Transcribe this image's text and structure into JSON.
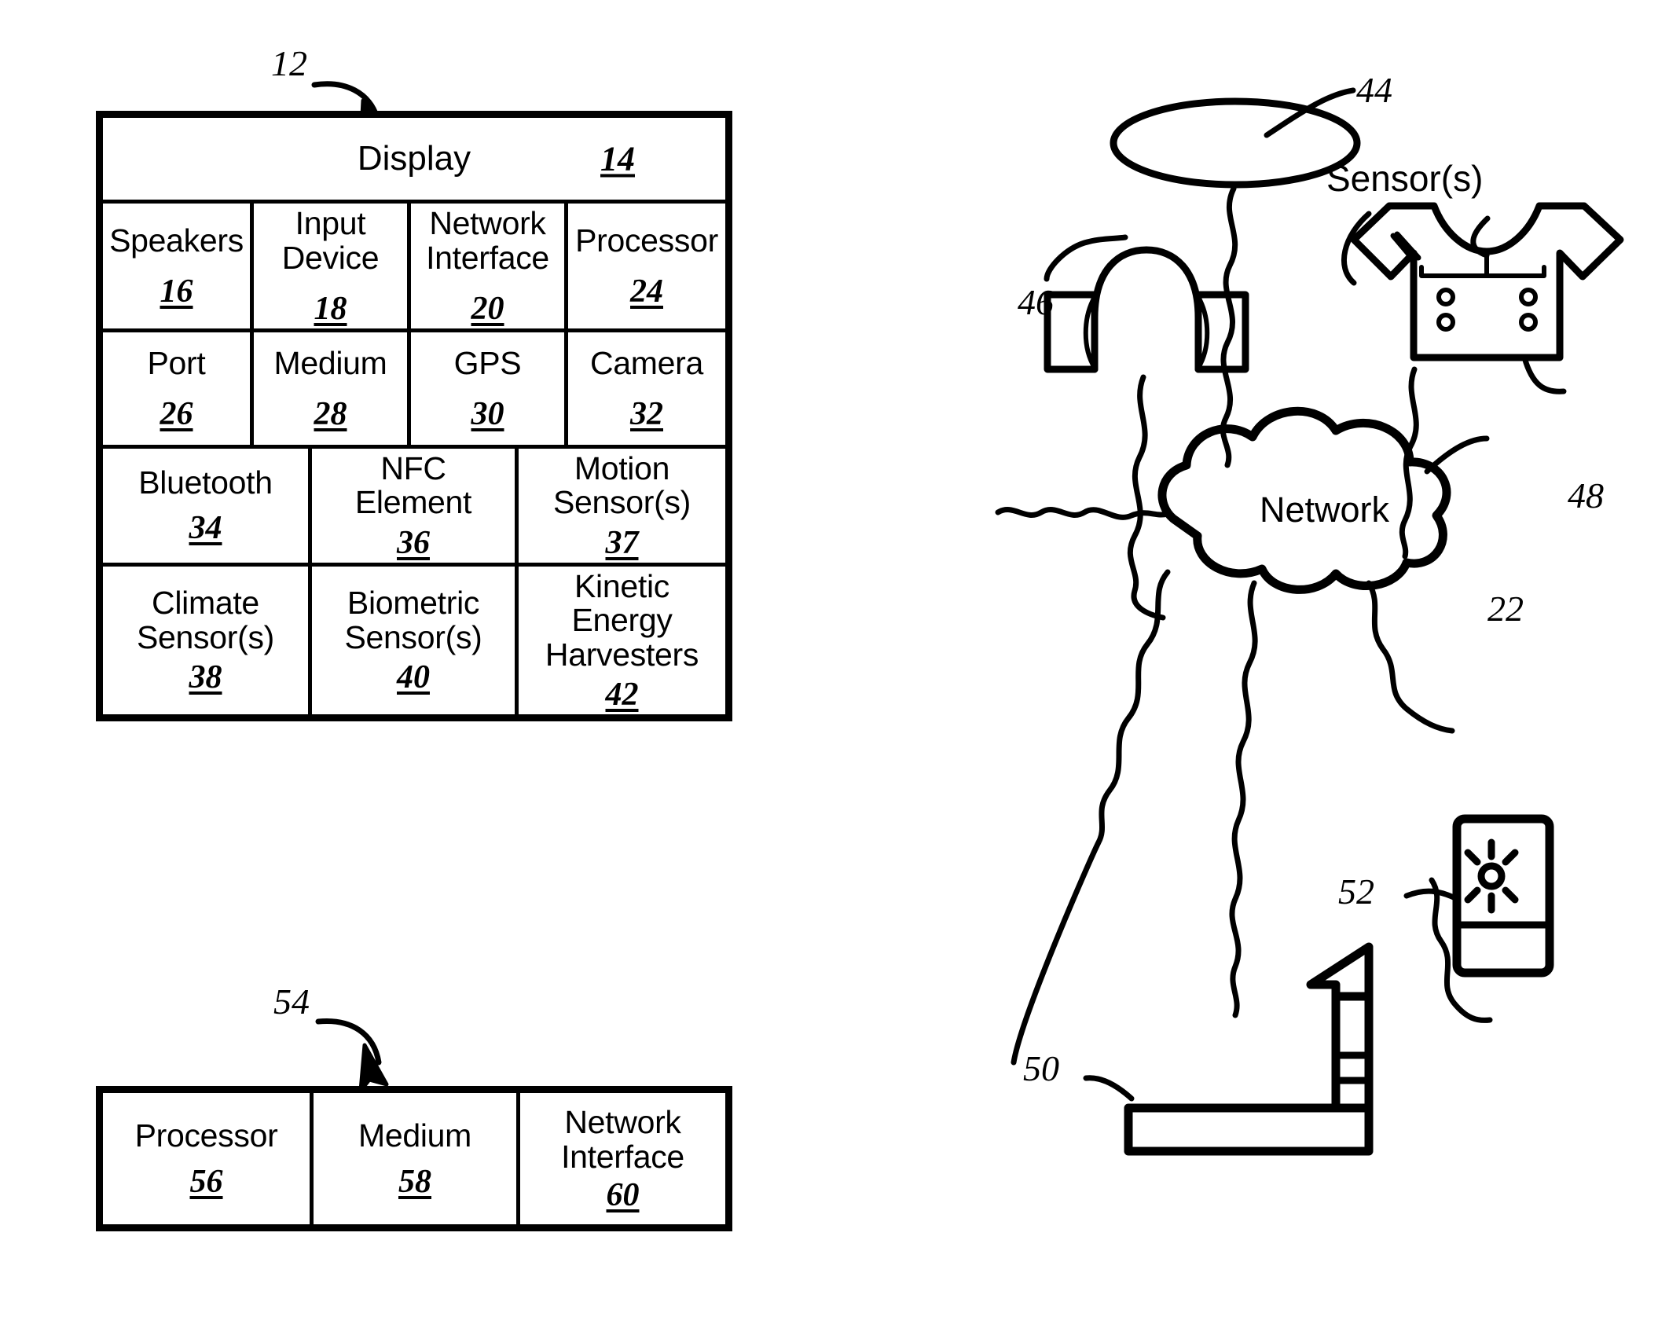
{
  "figure": {
    "device_block": {
      "ref": "12",
      "display": {
        "label": "Display",
        "num": "14"
      },
      "rows": [
        [
          {
            "label": "Speakers",
            "num": "16"
          },
          {
            "label": "Input\nDevice",
            "num": "18"
          },
          {
            "label": "Network\nInterface",
            "num": "20"
          },
          {
            "label": "Processor",
            "num": "24"
          }
        ],
        [
          {
            "label": "Port",
            "num": "26"
          },
          {
            "label": "Medium",
            "num": "28"
          },
          {
            "label": "GPS",
            "num": "30"
          },
          {
            "label": "Camera",
            "num": "32"
          }
        ],
        [
          {
            "label": "Bluetooth",
            "num": "34"
          },
          {
            "label": "NFC\nElement",
            "num": "36"
          },
          {
            "label": "Motion\nSensor(s)",
            "num": "37"
          }
        ],
        [
          {
            "label": "Climate\nSensor(s)",
            "num": "38"
          },
          {
            "label": "Biometric\nSensor(s)",
            "num": "40"
          },
          {
            "label": "Kinetic Energy\nHarvesters",
            "num": "42"
          }
        ]
      ]
    },
    "server_block": {
      "ref": "54",
      "cells": [
        {
          "label": "Processor",
          "num": "56"
        },
        {
          "label": "Medium",
          "num": "58"
        },
        {
          "label": "Network\nInterface",
          "num": "60"
        }
      ]
    },
    "network": {
      "label": "Network",
      "ref": "22"
    },
    "peripherals": [
      {
        "name": "ring-device",
        "ref": "44"
      },
      {
        "name": "headphone-device",
        "ref": "46"
      },
      {
        "name": "shirt-device",
        "ref": "48",
        "annotation": "Sensor(s)"
      },
      {
        "name": "exercise-equipment",
        "ref": "50"
      },
      {
        "name": "mobile-device",
        "ref": "52"
      }
    ],
    "colors": {
      "ink": "#000000",
      "background": "#ffffff"
    }
  }
}
